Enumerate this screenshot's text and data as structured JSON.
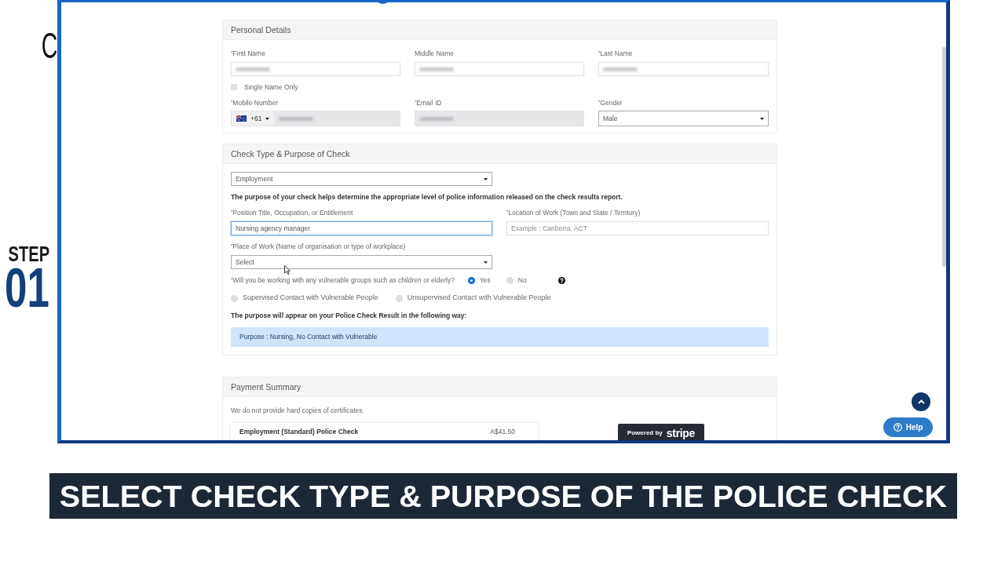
{
  "side": {
    "letter": "C",
    "step_label": "STEP",
    "step_number": "01"
  },
  "personal_details": {
    "title": "Personal Details",
    "name_fields": [
      {
        "label": "$^{*}$First Name",
        "kind": "text",
        "blurred": true,
        "disabled": false
      },
      {
        "label": "Middle Name",
        "kind": "text",
        "blurred": true,
        "disabled": false
      },
      {
        "label": "$^{*}$Last Name",
        "kind": "text",
        "blurred": true,
        "disabled": false
      }
    ],
    "single_name_only": {
      "label": "Single Name Only",
      "checked": false
    },
    "contact_fields": [
      {
        "label": "$^{*}$Mobile Number",
        "kind": "phone",
        "country_code": "+61",
        "blurred": true,
        "disabled": true
      },
      {
        "label": "$^{*}$Email ID",
        "kind": "text",
        "blurred": true,
        "disabled": true
      },
      {
        "label": "$^{*}$Gender",
        "kind": "select",
        "value": "Male",
        "disabled": false
      }
    ]
  },
  "check_type": {
    "title": "Check Type & Purpose of Check",
    "type_select": {
      "kind": "select",
      "value": "Employment"
    },
    "info_text": "The purpose of your check helps determine the appropriate level of police information released on the check results report.",
    "work_fields": [
      {
        "label": "$^{*}$Position Title, Occupation, or Entitlement",
        "kind": "input",
        "value": "Nursing agency manager",
        "focused": true
      },
      {
        "label": "$^{*}$Location of Work (Town and State / Territory)",
        "kind": "input",
        "placeholder": "Example : Canberra, ACT",
        "focused": false
      }
    ],
    "place_of_work": {
      "label": "$^{*}$Place of Work (Name of organisation or type of workplace)",
      "kind": "select",
      "value": "Select"
    },
    "vulnerable_question": {
      "label": "$^{*}$Will you be working with any vulnerable groups such as children or elderly?",
      "options": [
        {
          "label": "Yes",
          "selected": true
        },
        {
          "label": "No",
          "selected": false
        }
      ]
    },
    "contact_options": [
      {
        "label": "Supervised Contact with Vulnerable People",
        "selected": false
      },
      {
        "label": "Unsupervised Contact with Vulnerable People",
        "selected": false
      }
    ],
    "result_intro": "The purpose will appear on your Police Check Result in the following way:",
    "purpose_preview": "Purpose : Nursing, No Contact with Vulnerable"
  },
  "payment_summary": {
    "title": "Payment Summary",
    "note": "We do not provide hard copies of certificates.",
    "items": [
      {
        "name": "Employment (Standard) Police Check",
        "price": "A$41.50"
      }
    ]
  },
  "stripe_badge": {
    "prefix": "Powered by",
    "brand": "stripe"
  },
  "help_button": {
    "label": "Help"
  },
  "caption": "SELECT CHECK TYPE & PURPOSE OF THE POLICE CHECK"
}
